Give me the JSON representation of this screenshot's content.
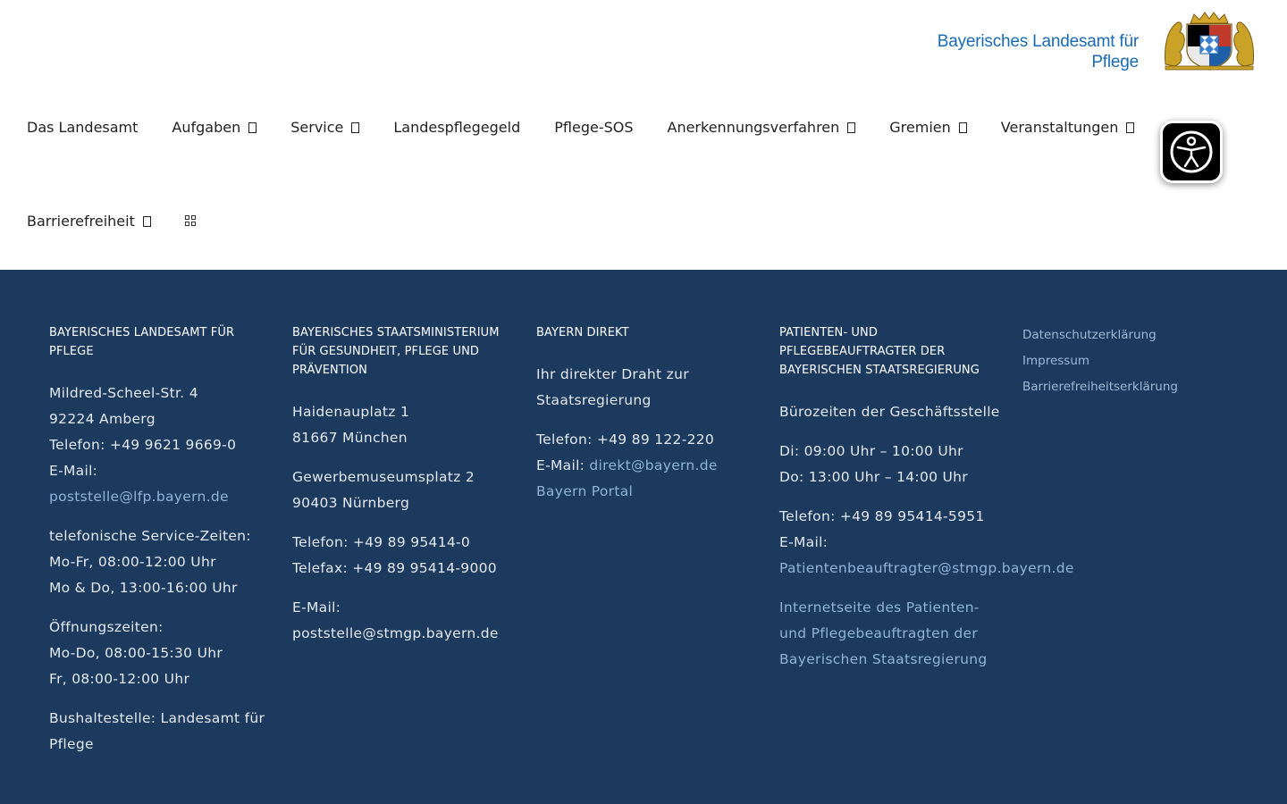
{
  "header": {
    "logo_line1": "Bayerisches Landesamt für",
    "logo_line2": "Pflege"
  },
  "nav": {
    "row1": [
      {
        "label": "Das Landesamt",
        "dropdown": false
      },
      {
        "label": "Aufgaben",
        "dropdown": true
      },
      {
        "label": "Service",
        "dropdown": true
      },
      {
        "label": "Landespflegegeld",
        "dropdown": false
      },
      {
        "label": "Pflege-SOS",
        "dropdown": false
      },
      {
        "label": "Anerkennungsverfahren",
        "dropdown": true
      },
      {
        "label": "Gremien",
        "dropdown": true
      },
      {
        "label": "Veranstaltungen",
        "dropdown": true
      }
    ],
    "row2": [
      {
        "label": "Barrierefreiheit",
        "dropdown": true
      }
    ],
    "accessibility_icon": "accessibility-person-icon"
  },
  "footer": {
    "colors": {
      "background": "#1b3a5e",
      "link": "#8fb4d8"
    },
    "col1": {
      "title": "BAYERISCHES LANDESAMT FÜR PFLEGE",
      "street": "Mildred-Scheel-Str. 4",
      "city": "92224 Amberg",
      "phone": "Telefon: +49 9621 9669-0",
      "email_label": "E-Mail:",
      "email": "poststelle@lfp.bayern.de",
      "service_label": "telefonische Service-Zeiten:",
      "service_1": "Mo-Fr, 08:00-12:00 Uhr",
      "service_2": "Mo & Do, 13:00-16:00 Uhr",
      "open_label": "Öffnungszeiten:",
      "open_1": "Mo-Do, 08:00-15:30 Uhr",
      "open_2": "Fr, 08:00-12:00 Uhr",
      "bus": "Bushaltestelle: Landesamt für Pflege"
    },
    "col2": {
      "title": "BAYERISCHES STAATSMINISTERIUM FÜR GESUNDHEIT, PFLEGE UND PRÄVENTION",
      "addr1_street": "Haidenauplatz 1",
      "addr1_city": "81667 München",
      "addr2_street": "Gewerbemuseumsplatz 2",
      "addr2_city": "90403 Nürnberg",
      "phone": "Telefon: +49 89 95414-0",
      "fax": "Telefax: +49 89 95414-9000",
      "email_label": "E-Mail:",
      "email": "poststelle@stmgp.bayern.de"
    },
    "col3": {
      "title": "BAYERN DIREKT",
      "intro": "Ihr direkter Draht zur Staatsregierung",
      "phone": "Telefon: +49 89 122-220",
      "email_label": "E-Mail: ",
      "email": "direkt@bayern.de",
      "portal": "Bayern Portal"
    },
    "col4": {
      "title": "PATIENTEN- UND PFLEGEBEAUFTRAGTER DER BAYERISCHEN STAATSREGIERUNG",
      "office_label": "Bürozeiten der Geschäftsstelle",
      "hours_1": "Di: 09:00 Uhr – 10:00 Uhr",
      "hours_2": "Do: 13:00 Uhr – 14:00 Uhr",
      "phone": "Telefon: +49 89 95414-5951",
      "email_label": "E-Mail:",
      "email": "Patientenbeauftragter@stmgp.bayern.de",
      "website": "Internetseite des Patienten- und Pflegebeauftragten der Bayerischen Staatsregierung"
    },
    "col5": {
      "links": [
        "Datenschutzerklärung",
        "Impressum",
        "Barrierefreiheitserklärung"
      ]
    }
  }
}
